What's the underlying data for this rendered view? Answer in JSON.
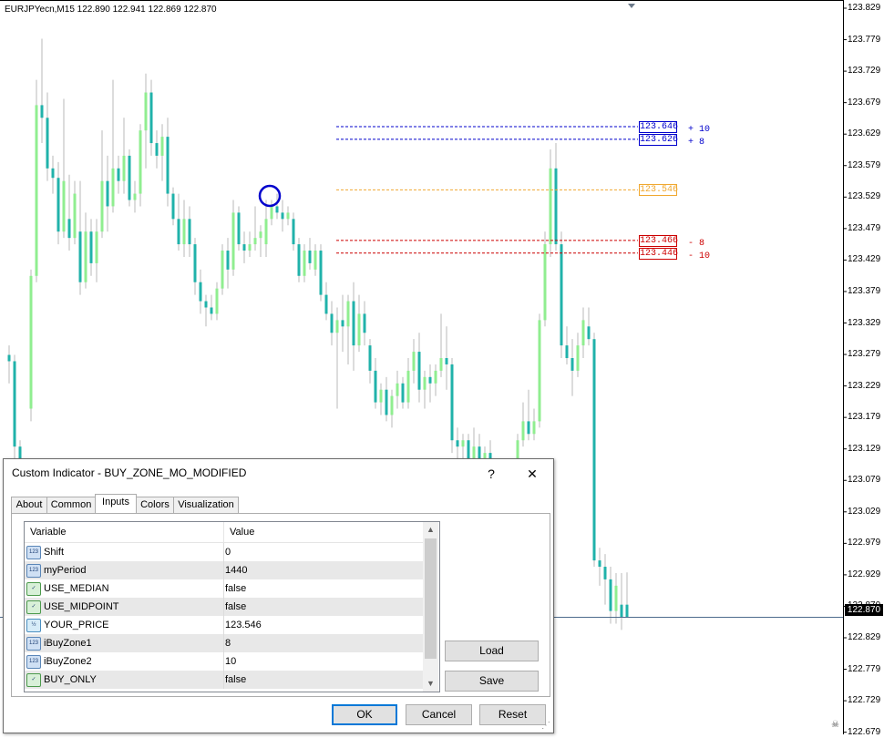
{
  "chart": {
    "symbol_info": "EURJPYecn,M15  122.890 122.941 122.869 122.870",
    "price_axis": [
      "123.829",
      "123.779",
      "123.729",
      "123.679",
      "123.629",
      "123.579",
      "123.529",
      "123.479",
      "123.429",
      "123.379",
      "123.329",
      "123.279",
      "123.229",
      "123.179",
      "123.129",
      "123.079",
      "123.029",
      "122.979",
      "122.929",
      "122.870",
      "122.829",
      "122.779",
      "122.729",
      "122.679"
    ],
    "current_price": "122.870",
    "levels": [
      {
        "price": "123.646",
        "note": "+ 10",
        "color": "#0000cc"
      },
      {
        "price": "123.626",
        "note": "+ 8",
        "color": "#0000cc"
      },
      {
        "price": "123.546",
        "note": "",
        "color": "#f0a830"
      },
      {
        "price": "123.466",
        "note": "- 8",
        "color": "#cc0000"
      },
      {
        "price": "123.446",
        "note": "- 10",
        "color": "#cc0000"
      }
    ],
    "bull_color": "#90ee90",
    "bear_color": "#20b2aa",
    "marker_icon": "circle-marker-icon"
  },
  "dialog": {
    "title": "Custom Indicator - BUY_ZONE_MO_MODIFIED",
    "help_label": "?",
    "close_label": "✕",
    "tabs": [
      "About",
      "Common",
      "Inputs",
      "Colors",
      "Visualization"
    ],
    "active_tab": "Inputs",
    "grid": {
      "col_variable": "Variable",
      "col_value": "Value",
      "rows": [
        {
          "name": "Shift",
          "value": "0",
          "type": "123"
        },
        {
          "name": "myPeriod",
          "value": "1440",
          "type": "123"
        },
        {
          "name": "USE_MEDIAN",
          "value": "false",
          "type": "bool"
        },
        {
          "name": "USE_MIDPOINT",
          "value": "false",
          "type": "bool"
        },
        {
          "name": "YOUR_PRICE",
          "value": "123.546",
          "type": "½"
        },
        {
          "name": "iBuyZone1",
          "value": "8",
          "type": "123"
        },
        {
          "name": "iBuyZone2",
          "value": "10",
          "type": "123"
        },
        {
          "name": "BUY_ONLY",
          "value": "false",
          "type": "bool"
        }
      ]
    },
    "load_label": "Load",
    "save_label": "Save",
    "ok_label": "OK",
    "cancel_label": "Cancel",
    "reset_label": "Reset"
  }
}
